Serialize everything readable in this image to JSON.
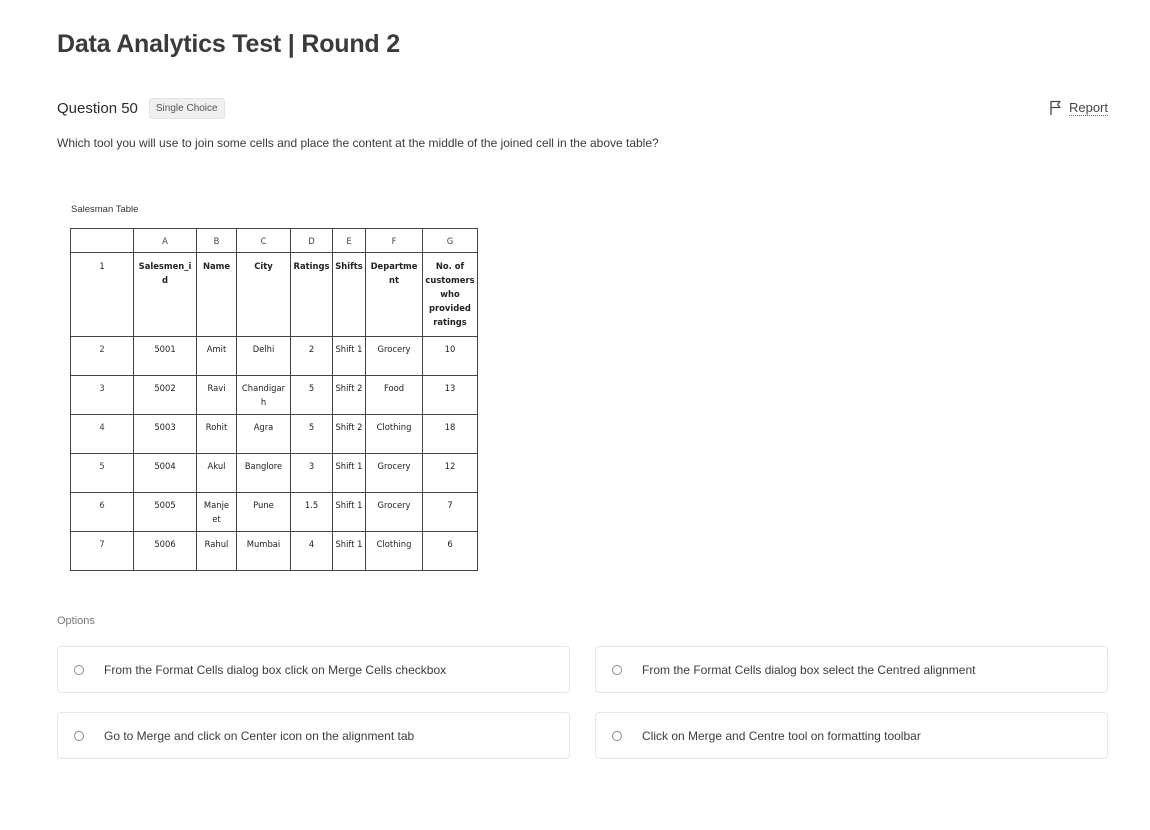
{
  "test_title": "Data Analytics Test | Round 2",
  "question": {
    "number_label": "Question 50",
    "type_badge": "Single Choice",
    "text": "Which tool you will use to join some cells and place the content at the middle of the joined cell in the above table?"
  },
  "report": {
    "label": "Report",
    "icon": "flag-icon"
  },
  "table": {
    "caption": "Salesman Table",
    "column_letters": [
      "",
      "A",
      "B",
      "C",
      "D",
      "E",
      "F",
      "G"
    ],
    "header_row": {
      "row_num": "1",
      "cells": [
        "Salesmen_i d",
        "Name",
        "City",
        "Ratings",
        "Shifts",
        "Departme nt",
        "No. of customers who provided ratings"
      ]
    },
    "rows": [
      {
        "row_num": "2",
        "cells": [
          "5001",
          "Amit",
          "Delhi",
          "2",
          "Shift 1",
          "Grocery",
          "10"
        ]
      },
      {
        "row_num": "3",
        "cells": [
          "5002",
          "Ravi",
          "Chandigar h",
          "5",
          "Shift 2",
          "Food",
          "13"
        ]
      },
      {
        "row_num": "4",
        "cells": [
          "5003",
          "Rohit",
          "Agra",
          "5",
          "Shift 2",
          "Clothing",
          "18"
        ]
      },
      {
        "row_num": "5",
        "cells": [
          "5004",
          "Akul",
          "Banglore",
          "3",
          "Shift 1",
          "Grocery",
          "12"
        ]
      },
      {
        "row_num": "6",
        "cells": [
          "5005",
          "Manje et",
          "Pune",
          "1.5",
          "Shift 1",
          "Grocery",
          "7"
        ]
      },
      {
        "row_num": "7",
        "cells": [
          "5006",
          "Rahul",
          "Mumbai",
          "4",
          "Shift 1",
          "Clothing",
          "6"
        ]
      }
    ]
  },
  "options": {
    "label": "Options",
    "items": [
      "From the Format Cells dialog box click on Merge Cells checkbox",
      "From the Format Cells dialog box select the Centred alignment",
      "Go to Merge and click on Center icon on the alignment tab",
      "Click on Merge and Centre tool on formatting toolbar"
    ]
  }
}
